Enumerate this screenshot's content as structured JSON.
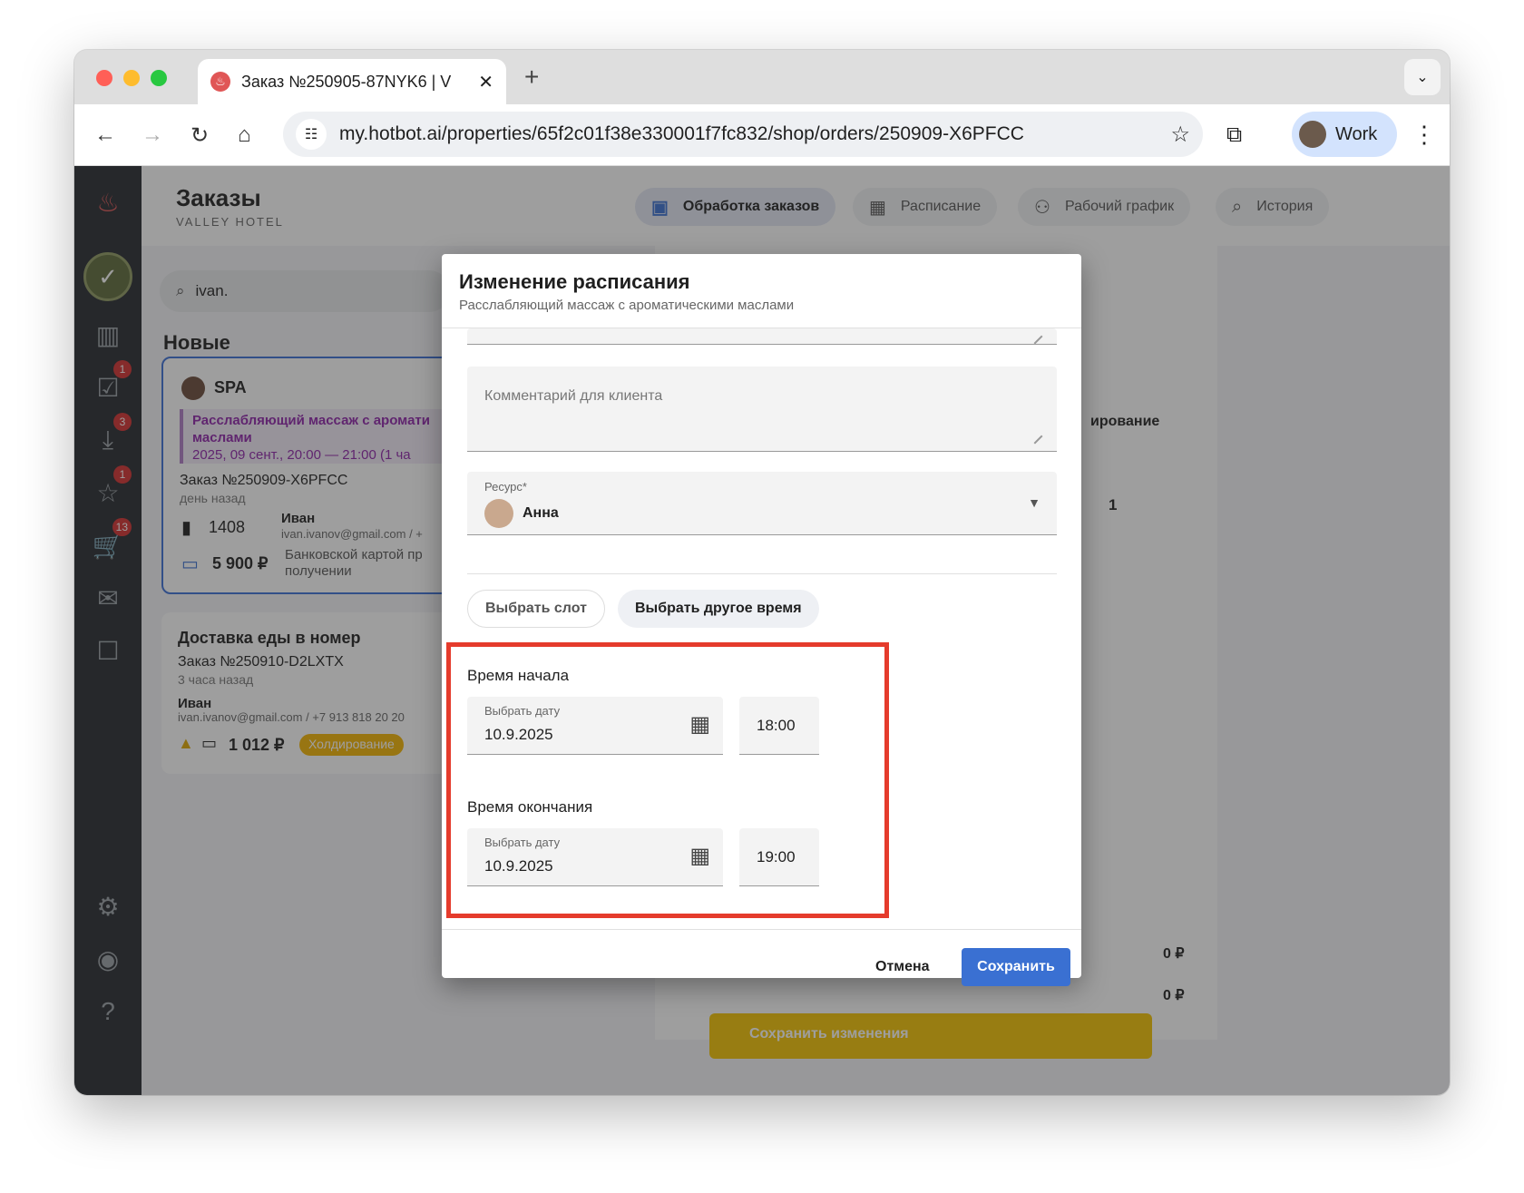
{
  "browser": {
    "tab_title": "Заказ №250905-87NYK6 | V",
    "url": "my.hotbot.ai/properties/65f2c01f38e330001f7fc832/shop/orders/250909-X6PFCC",
    "profile_label": "Work"
  },
  "header": {
    "title": "Заказы",
    "subtitle": "VALLEY HOTEL",
    "tabs": [
      {
        "label": "Обработка заказов",
        "icon": "inbox-icon"
      },
      {
        "label": "Расписание",
        "icon": "calendar-icon"
      },
      {
        "label": "Рабочий график",
        "icon": "staff-icon"
      },
      {
        "label": "История",
        "icon": "history-search-icon"
      }
    ]
  },
  "sidebar": {
    "badges": {
      "tasks": "1",
      "inbox": "3",
      "reviews": "1",
      "cart": "13"
    }
  },
  "search": {
    "value": "ivan."
  },
  "list": {
    "section_title": "Новые",
    "card1": {
      "category": "SPA",
      "service": "Расслабляющий массаж с аромати",
      "service2": "маслами",
      "time": "2025, 09 сент., 20:00 — 21:00  (1 ча",
      "order_no": "Заказ №250909-X6PFCC",
      "ago": "день назад",
      "room": "1408",
      "guest_name": "Иван",
      "guest_contact": "ivan.ivanov@gmail.com / +",
      "price": "5 900 ₽",
      "payment": "Банковской картой пр",
      "payment2": "получении"
    },
    "card2": {
      "title": "Доставка еды в номер",
      "order_no": "Заказ №250910-D2LXTX",
      "ago": "3 часа назад",
      "guest_name": "Иван",
      "guest_contact": "ivan.ivanov@gmail.com / +7 913 818 20 20",
      "price": "1 012 ₽",
      "status": "Холдирование"
    }
  },
  "right_panel": {
    "status_partial": "ирование",
    "qty": "1",
    "sum1": "0 ₽",
    "sum2": "0 ₽",
    "save_changes": "Сохранить изменения"
  },
  "modal": {
    "title": "Изменение расписания",
    "subtitle": "Расслабляющий массаж с ароматическими маслами",
    "comment_placeholder": "Комментарий для клиента",
    "resource_label": "Ресурс*",
    "resource_value": "Анна",
    "btn_slot": "Выбрать слот",
    "btn_other": "Выбрать другое время",
    "start": {
      "label": "Время начала",
      "date_label": "Выбрать дату",
      "date": "10.9.2025",
      "time": "18:00"
    },
    "end": {
      "label": "Время окончания",
      "date_label": "Выбрать дату",
      "date": "10.9.2025",
      "time": "19:00"
    },
    "cancel": "Отмена",
    "save": "Сохранить"
  },
  "colors": {
    "accent": "#3a70d2",
    "highlight": "#e53b2c",
    "sidebar": "#26292e",
    "purple": "#8e24aa"
  }
}
